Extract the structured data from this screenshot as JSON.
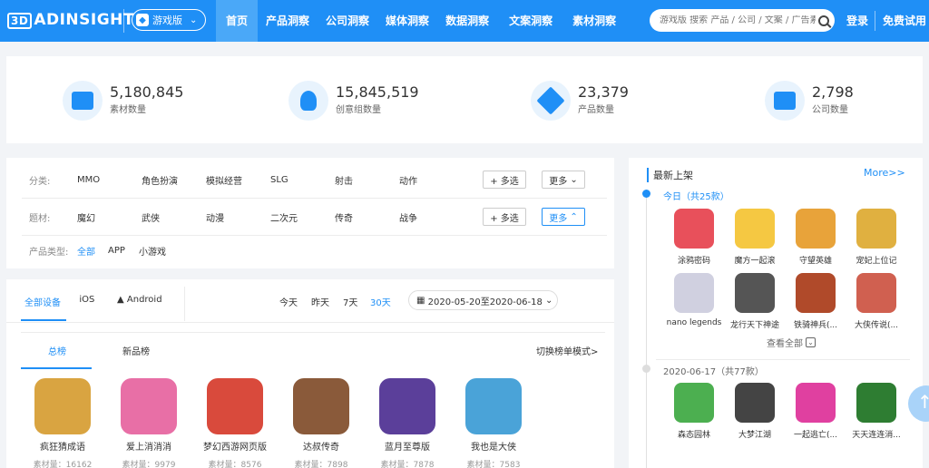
{
  "nav": {
    "logo": "ADINSIGHT",
    "edition": "游戏版",
    "items": [
      "首页",
      "产品洞察",
      "公司洞察",
      "媒体洞察",
      "数据洞察",
      "文案洞察",
      "素材洞察"
    ],
    "search_placeholder": "游戏版 搜索 产品 / 公司 / 文案 / 广告素材",
    "login": "登录",
    "trial": "免费试用"
  },
  "stats": [
    {
      "value": "5,180,845",
      "label": "素材数量",
      "icon": "image-icon"
    },
    {
      "value": "15,845,519",
      "label": "创意组数量",
      "icon": "lightbulb-icon"
    },
    {
      "value": "23,379",
      "label": "产品数量",
      "icon": "cube-icon"
    },
    {
      "value": "2,798",
      "label": "公司数量",
      "icon": "code-window-icon"
    }
  ],
  "filters": {
    "category_label": "分类:",
    "categories": [
      "MMO",
      "角色扮演",
      "模拟经营",
      "SLG",
      "射击",
      "动作"
    ],
    "theme_label": "题材:",
    "themes": [
      "魔幻",
      "武侠",
      "动漫",
      "二次元",
      "传奇",
      "战争"
    ],
    "multi_label": "+ 多选",
    "more_label": "更多",
    "ptype_label": "产品类型:",
    "ptypes": [
      "全部",
      "APP",
      "小游戏"
    ]
  },
  "devices": [
    "全部设备",
    "iOS",
    "Android"
  ],
  "days": [
    "今天",
    "昨天",
    "7天",
    "30天"
  ],
  "date_range": "2020-05-20至2020-06-18",
  "rank": {
    "tabs": [
      "总榜",
      "新品榜"
    ],
    "switch_label": "切换榜单模式>",
    "items": [
      {
        "name": "疯狂猜成语",
        "count": "素材量：16162",
        "color": "#d9a441"
      },
      {
        "name": "爱上消消消",
        "count": "素材量：9979",
        "color": "#e86fa6"
      },
      {
        "name": "梦幻西游网页版",
        "count": "素材量：8576",
        "color": "#d94a3c"
      },
      {
        "name": "达叔传奇",
        "count": "素材量：7898",
        "color": "#8a5a3a"
      },
      {
        "name": "蓝月至尊版",
        "count": "素材量：7878",
        "color": "#5b3f9a"
      },
      {
        "name": "我也是大侠",
        "count": "素材量：7583",
        "color": "#4aa3d8"
      }
    ]
  },
  "side": {
    "title": "最新上架",
    "more": "More>>",
    "today_label": "今日（共25款）",
    "today_apps": [
      {
        "name": "涂鸦密码",
        "color": "#e8505b"
      },
      {
        "name": "魔方一起滚",
        "color": "#f5c842"
      },
      {
        "name": "守望英雄",
        "color": "#e8a33a"
      },
      {
        "name": "宠妃上位记",
        "color": "#e0b040"
      },
      {
        "name": "nano legends",
        "color": "#d0d0e0"
      },
      {
        "name": "龙行天下神途",
        "color": "#555555"
      },
      {
        "name": "铁骑神兵(...",
        "color": "#b04a2a"
      },
      {
        "name": "大侠传说(...",
        "color": "#d06050"
      }
    ],
    "view_all": "查看全部",
    "day2_label": "2020-06-17（共77款）",
    "day2_apps": [
      {
        "name": "森态园林",
        "color": "#4caf50"
      },
      {
        "name": "大梦江湖",
        "color": "#444444"
      },
      {
        "name": "一起逃亡(...",
        "color": "#e040a0"
      },
      {
        "name": "天天连连消...",
        "color": "#2e7d32"
      }
    ]
  }
}
